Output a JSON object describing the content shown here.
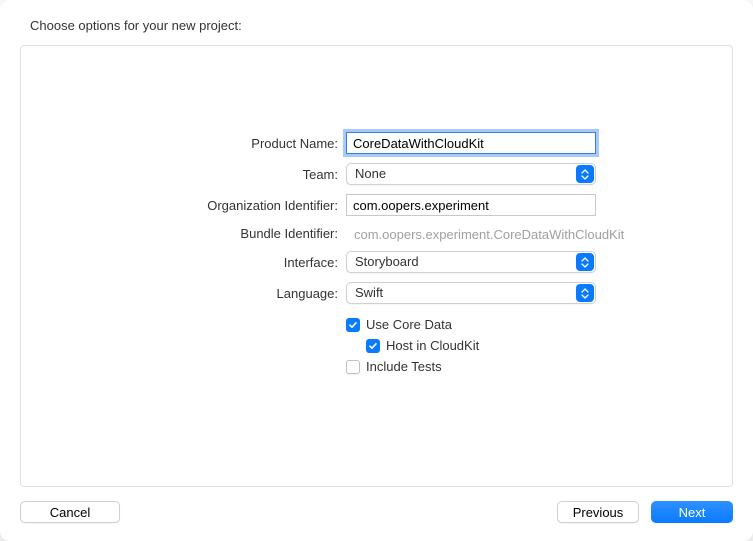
{
  "heading": "Choose options for your new project:",
  "form": {
    "product_name": {
      "label": "Product Name:",
      "value": "CoreDataWithCloudKit"
    },
    "team": {
      "label": "Team:",
      "value": "None"
    },
    "org_identifier": {
      "label": "Organization Identifier:",
      "value": "com.oopers.experiment"
    },
    "bundle_identifier": {
      "label": "Bundle Identifier:",
      "value": "com.oopers.experiment.CoreDataWithCloudKit"
    },
    "interface": {
      "label": "Interface:",
      "value": "Storyboard"
    },
    "language": {
      "label": "Language:",
      "value": "Swift"
    },
    "use_core_data": {
      "label": "Use Core Data",
      "checked": true
    },
    "host_cloudkit": {
      "label": "Host in CloudKit",
      "checked": true
    },
    "include_tests": {
      "label": "Include Tests",
      "checked": false
    }
  },
  "footer": {
    "cancel": "Cancel",
    "previous": "Previous",
    "next": "Next"
  }
}
